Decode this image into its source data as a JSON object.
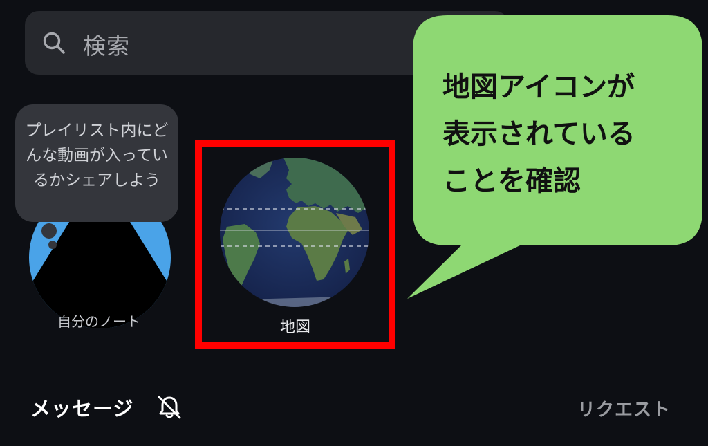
{
  "search": {
    "placeholder": "検索"
  },
  "notes": {
    "my_note": {
      "tooltip": "プレイリスト内にどんな動画が入っているかシェアしよう",
      "label": "自分のノート"
    },
    "map_note": {
      "label": "地図"
    }
  },
  "callout": {
    "text": "地図アイコンが\n表示されている\nことを確認"
  },
  "messages": {
    "title": "メッセージ",
    "requests_label": "リクエスト"
  },
  "icons": {
    "search": "search-icon",
    "mute": "bell-off-icon",
    "globe": "globe-map-icon"
  },
  "colors": {
    "background": "#0d0f14",
    "highlight": "#ff0000",
    "callout": "#8ed873",
    "avatar_blue": "#4aa3e8"
  }
}
